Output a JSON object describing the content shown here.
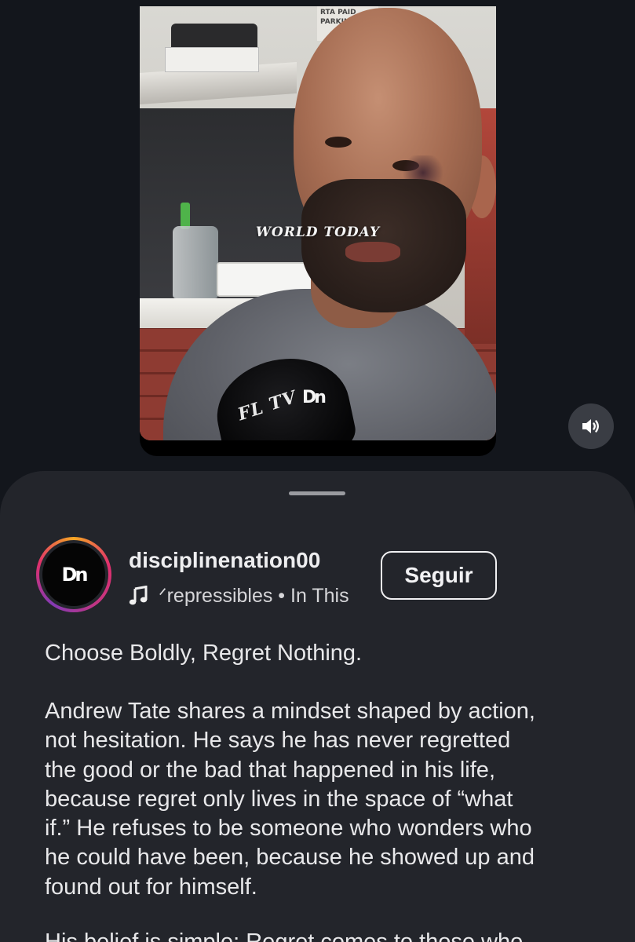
{
  "video": {
    "overlay_caption": "WORLD TODAY",
    "sign_text": "RTA PAID PARKING",
    "mic_label": "FL TV",
    "watermark": "Dn"
  },
  "controls": {
    "volume_icon": "speaker-icon"
  },
  "post": {
    "avatar_text": "Dn",
    "username": "disciplinenation00",
    "music_icon": "music-note-icon",
    "audio_line": "ᐟrepressibles • In This",
    "follow_label": "Seguir",
    "caption_title": "Choose Boldly, Regret Nothing.",
    "caption_lines": [
      "Andrew Tate shares a mindset shaped by action,",
      "not hesitation. He says he has never regretted",
      "the good or the bad that happened in his life,",
      "because regret only lives in the space of “what",
      "if.” He refuses to be someone who wonders who",
      "he could have been, because he showed up and",
      "found out for himself."
    ],
    "caption_next_partial": "His belief is simple: Regret comes to those who"
  },
  "colors": {
    "background": "#13161c",
    "sheet": "#23252b",
    "text": "#e8e8ea",
    "ring_gradient_start": "#f5a623",
    "ring_gradient_mid": "#e1306c"
  }
}
